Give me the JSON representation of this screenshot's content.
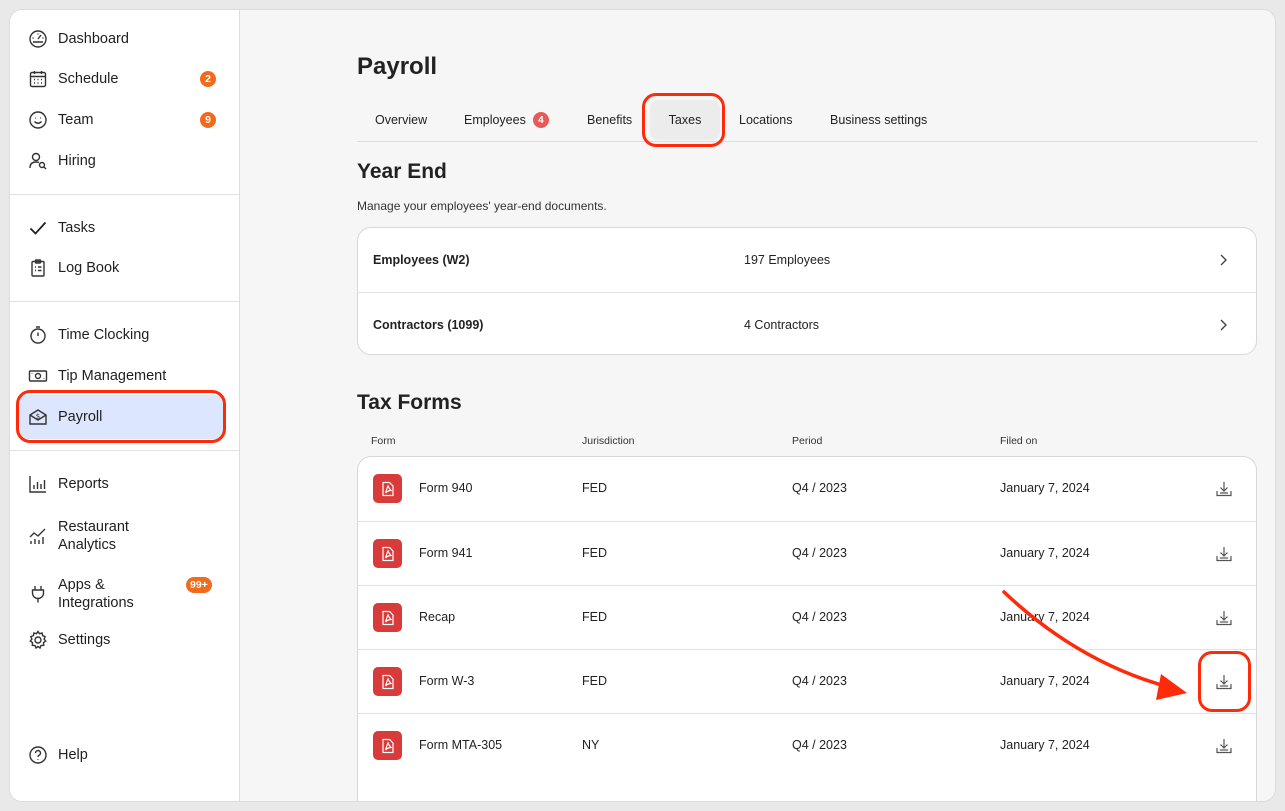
{
  "sidebar": {
    "items": [
      {
        "label": "Dashboard"
      },
      {
        "label": "Schedule",
        "badge": "2"
      },
      {
        "label": "Team",
        "badge": "9"
      },
      {
        "label": "Hiring"
      },
      {
        "label": "Tasks"
      },
      {
        "label": "Log Book"
      },
      {
        "label": "Time Clocking"
      },
      {
        "label": "Tip Management"
      },
      {
        "label": "Payroll",
        "active": true
      },
      {
        "label": "Reports"
      },
      {
        "label": "Restaurant",
        "label2": "Analytics"
      },
      {
        "label": "Apps &",
        "label2": "Integrations",
        "badge": "99+"
      },
      {
        "label": "Settings"
      },
      {
        "label": "Help"
      }
    ]
  },
  "page": {
    "title": "Payroll",
    "tabs": [
      {
        "label": "Overview"
      },
      {
        "label": "Employees",
        "badge": "4"
      },
      {
        "label": "Benefits"
      },
      {
        "label": "Taxes",
        "active": true
      },
      {
        "label": "Locations"
      },
      {
        "label": "Business settings"
      }
    ]
  },
  "year_end": {
    "title": "Year End",
    "subtitle": "Manage your employees' year-end documents.",
    "rows": [
      {
        "label": "Employees (W2)",
        "count": "197 Employees"
      },
      {
        "label": "Contractors (1099)",
        "count": "4 Contractors"
      }
    ]
  },
  "tax_forms": {
    "title": "Tax Forms",
    "columns": [
      "Form",
      "Jurisdiction",
      "Period",
      "Filed on"
    ],
    "rows": [
      {
        "form": "Form 940",
        "jurisdiction": "FED",
        "period": "Q4 / 2023",
        "filed_on": "January 7, 2024"
      },
      {
        "form": "Form 941",
        "jurisdiction": "FED",
        "period": "Q4 / 2023",
        "filed_on": "January 7, 2024"
      },
      {
        "form": "Recap",
        "jurisdiction": "FED",
        "period": "Q4 / 2023",
        "filed_on": "January 7, 2024"
      },
      {
        "form": "Form W-3",
        "jurisdiction": "FED",
        "period": "Q4 / 2023",
        "filed_on": "January 7, 2024"
      },
      {
        "form": "Form MTA-305",
        "jurisdiction": "NY",
        "period": "Q4 / 2023",
        "filed_on": "January 7, 2024"
      }
    ]
  },
  "colors": {
    "accent_highlight": "#ff2a0a",
    "badge_orange": "#f26a1b",
    "pdf_red": "#d93a3a",
    "active_nav": "#dce6ff"
  },
  "icons": [
    "dashboard-gauge-icon",
    "calendar-icon",
    "smiley-icon",
    "person-search-icon",
    "checkmark-icon",
    "clipboard-icon",
    "stopwatch-icon",
    "banknote-icon",
    "payroll-envelope-icon",
    "bar-chart-icon",
    "line-chart-icon",
    "plug-icon",
    "gear-icon",
    "help-circle-icon",
    "pdf-icon",
    "download-icon",
    "chevron-right-icon"
  ]
}
